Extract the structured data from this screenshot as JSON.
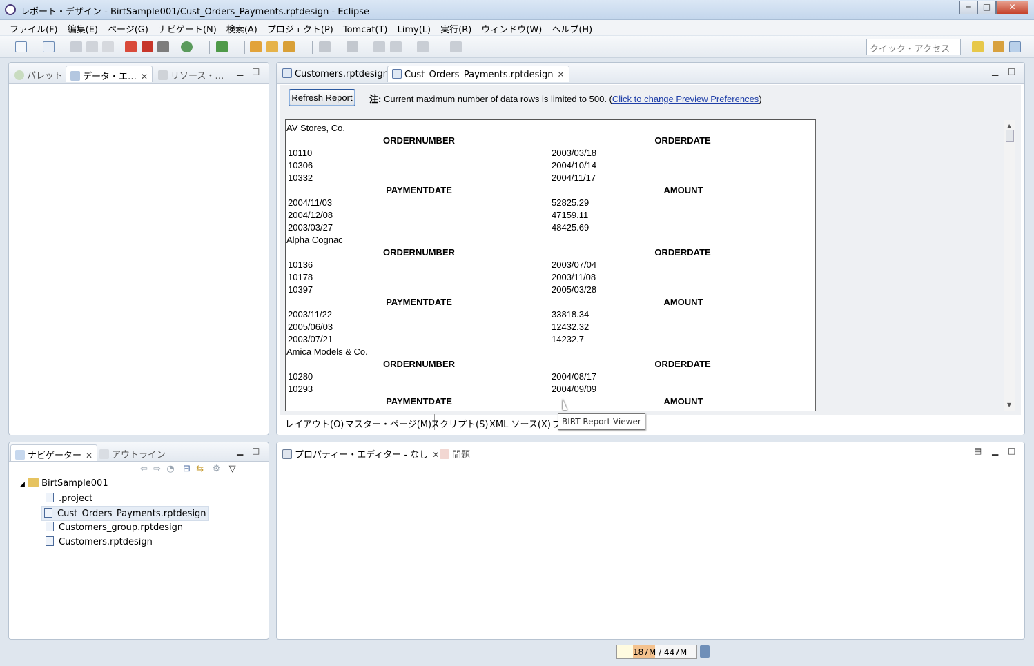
{
  "window": {
    "title": "レポート・デザイン - BirtSample001/Cust_Orders_Payments.rptdesign - Eclipse",
    "controls": [
      "─",
      "□",
      "✕"
    ]
  },
  "menu": [
    "ファイル(F)",
    "編集(E)",
    "ページ(G)",
    "ナビゲート(N)",
    "検索(A)",
    "プロジェクト(P)",
    "Tomcat(T)",
    "Limy(L)",
    "実行(R)",
    "ウィンドウ(W)",
    "ヘルプ(H)"
  ],
  "quick_access": {
    "placeholder": "クイック・アクセス"
  },
  "left_top_tabs": [
    "パレット",
    "データ・エ…",
    "リソース・…"
  ],
  "editor_tabs": [
    "Customers.rptdesign",
    "Cust_Orders_Payments.rptdesign"
  ],
  "preview": {
    "refresh_label": "Refresh Report",
    "note_prefix": "注:",
    "note_text": "Current maximum number of data rows is limited to 500. (",
    "note_link": "Click to change Preview Preferences",
    "note_suffix": ")"
  },
  "report": [
    {
      "customer": "AV Stores, Co.",
      "orders": [
        [
          "10110",
          "2003/03/18"
        ],
        [
          "10306",
          "2004/10/14"
        ],
        [
          "10332",
          "2004/11/17"
        ]
      ],
      "payments": [
        [
          "2004/11/03",
          "52825.29"
        ],
        [
          "2004/12/08",
          "47159.11"
        ],
        [
          "2003/03/27",
          "48425.69"
        ]
      ]
    },
    {
      "customer": "Alpha Cognac",
      "orders": [
        [
          "10136",
          "2003/07/04"
        ],
        [
          "10178",
          "2003/11/08"
        ],
        [
          "10397",
          "2005/03/28"
        ]
      ],
      "payments": [
        [
          "2003/11/22",
          "33818.34"
        ],
        [
          "2005/06/03",
          "12432.32"
        ],
        [
          "2003/07/21",
          "14232.7"
        ]
      ]
    },
    {
      "customer": "Amica Models & Co.",
      "orders": [
        [
          "10280",
          "2004/08/17"
        ],
        [
          "10293",
          "2004/09/09"
        ]
      ],
      "payments": []
    }
  ],
  "report_headers": {
    "order_number": "ORDERNUMBER",
    "order_date": "ORDERDATE",
    "payment_date": "PAYMENTDATE",
    "amount": "AMOUNT"
  },
  "layout_tabs": [
    "レイアウト(O)",
    "マスター・ページ(M)",
    "スクリプト(S)",
    "XML ソース(X)",
    "プ"
  ],
  "tooltip": "BIRT Report Viewer",
  "navigator": {
    "tabs": [
      "ナビゲーター",
      "アウトライン"
    ],
    "project": "BirtSample001",
    "files": [
      ".project",
      "Cust_Orders_Payments.rptdesign",
      "Customers_group.rptdesign",
      "Customers.rptdesign"
    ],
    "selected_index": 1
  },
  "bottom_tabs": [
    "プロパティー・エディター - なし",
    "問題"
  ],
  "status": {
    "heap_used": "187M",
    "heap_total": "447M"
  },
  "colors": {
    "link": "#1f3fa8",
    "selection": "#e6edf6",
    "heap_fill": "#f4c28e"
  }
}
